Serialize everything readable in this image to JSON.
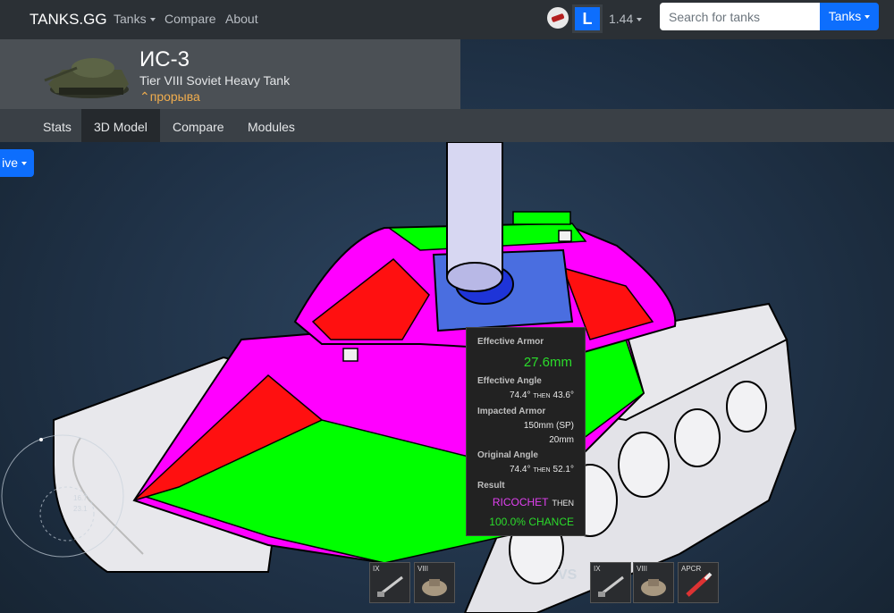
{
  "nav": {
    "brand": "TANKS.GG",
    "tanks_label": "Tanks",
    "compare_label": "Compare",
    "about_label": "About",
    "lesta_badge": "L",
    "version": "1.44",
    "search_placeholder": "Search for tanks",
    "search_button_label": "Tanks"
  },
  "tank": {
    "name": "ИС-3",
    "subtitle": "Tier VIII Soviet Heavy Tank",
    "role": "прорыва"
  },
  "tabs": [
    {
      "label": "Stats",
      "active": false
    },
    {
      "label": "3D Model",
      "active": true
    },
    {
      "label": "Compare",
      "active": false
    },
    {
      "label": "Modules",
      "active": false
    }
  ],
  "view_dropdown_label": "ive",
  "tooltip": {
    "effective_armor_label": "Effective Armor",
    "effective_armor_value": "27.6mm",
    "effective_angle_label": "Effective Angle",
    "effective_angle_first": "74.4°",
    "effective_angle_then": "THEN",
    "effective_angle_second": "43.6°",
    "impacted_armor_label": "Impacted Armor",
    "impacted_armor_1": "150mm (SP)",
    "impacted_armor_2": "20mm",
    "original_angle_label": "Original Angle",
    "original_angle_first": "74.4°",
    "original_angle_then": "THEN",
    "original_angle_second": "52.1°",
    "result_label": "Result",
    "result_value": "RICOCHET",
    "result_then": "THEN",
    "result_chance": "100.0% CHANCE"
  },
  "compass": {
    "value_1": "16.7",
    "value_2": "23.1"
  },
  "bottom": {
    "left_slots": [
      {
        "tier": "IX",
        "icon": "gun-icon"
      },
      {
        "tier": "VIII",
        "icon": "turret-icon"
      }
    ],
    "vs_label": "VS",
    "right_slots": [
      {
        "tier": "IX",
        "icon": "gun-icon"
      },
      {
        "tier": "VIII",
        "icon": "turret-icon"
      },
      {
        "tier": "APCR",
        "icon": "shell-icon"
      }
    ]
  },
  "colors": {
    "navbar": "#2b3035",
    "header": "#4b5055",
    "tabs": "#3a4046",
    "accent_blue": "#0d6efd",
    "role_orange": "#f0ad4e",
    "armor_magenta": "#ff00ff",
    "armor_green": "#00ff00",
    "armor_red": "#ff1010",
    "ricochet_text": "#e040f0",
    "chance_text": "#2bdc2b"
  }
}
